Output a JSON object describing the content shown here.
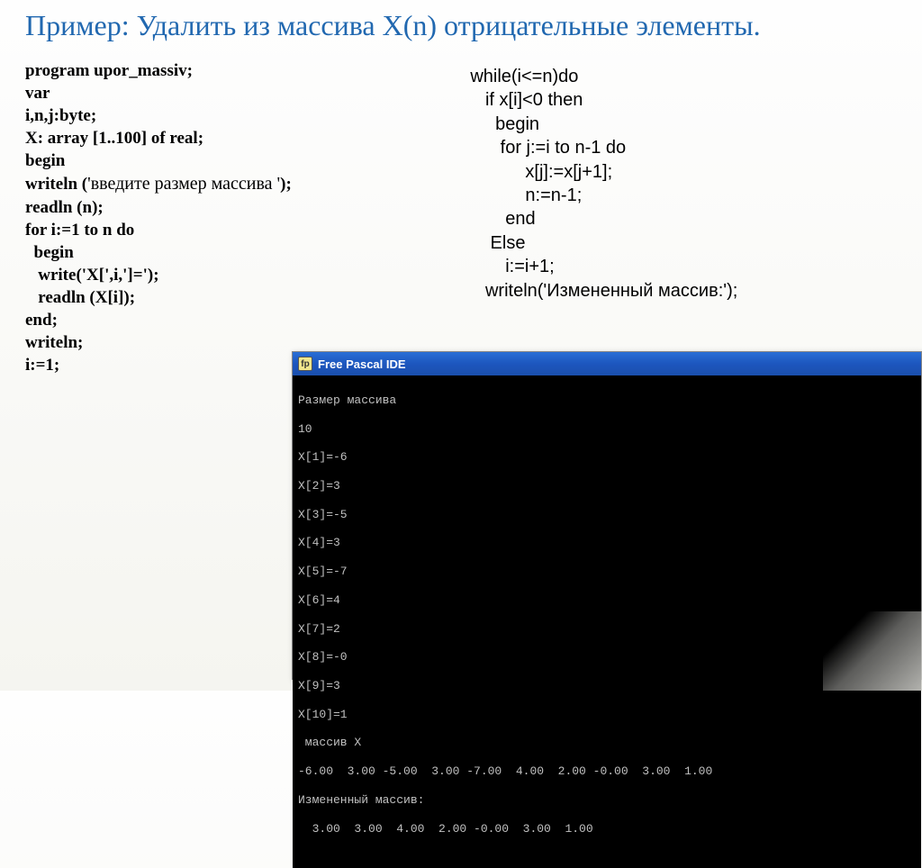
{
  "title": "Пример: Удалить из массива X(n) отрицательные элементы.",
  "code_left": [
    "program upor_massiv;",
    "var",
    "i,n,j:byte;",
    "X: array [1..100] of real;",
    "begin",
    "writeln ('введите размер массива ');",
    "readln (n);",
    "for i:=1 to n do",
    "  begin",
    "   write('X[',i,']=');",
    "   readln (X[i]);",
    "end;",
    "writeln;",
    "i:=1;"
  ],
  "code_right": [
    "while(i<=n)do",
    "   if x[i]<0 then",
    "     begin",
    "      for j:=i to n-1 do",
    "           x[j]:=x[j+1];",
    "           n:=n-1;",
    "       end",
    "    Else",
    "       i:=i+1;",
    "   writeln('Измененный массив:');"
  ],
  "ide": {
    "title": "Free Pascal IDE",
    "output": [
      "Размер массива",
      "10",
      "X[1]=-6",
      "X[2]=3",
      "X[3]=-5",
      "X[4]=3",
      "X[5]=-7",
      "X[6]=4",
      "X[7]=2",
      "X[8]=-0",
      "X[9]=3",
      "X[10]=1",
      " массив X",
      "-6.00  3.00 -5.00  3.00 -7.00  4.00  2.00 -0.00  3.00  1.00",
      "Измененный массив:",
      "  3.00  3.00  4.00  2.00 -0.00  3.00  1.00"
    ]
  }
}
